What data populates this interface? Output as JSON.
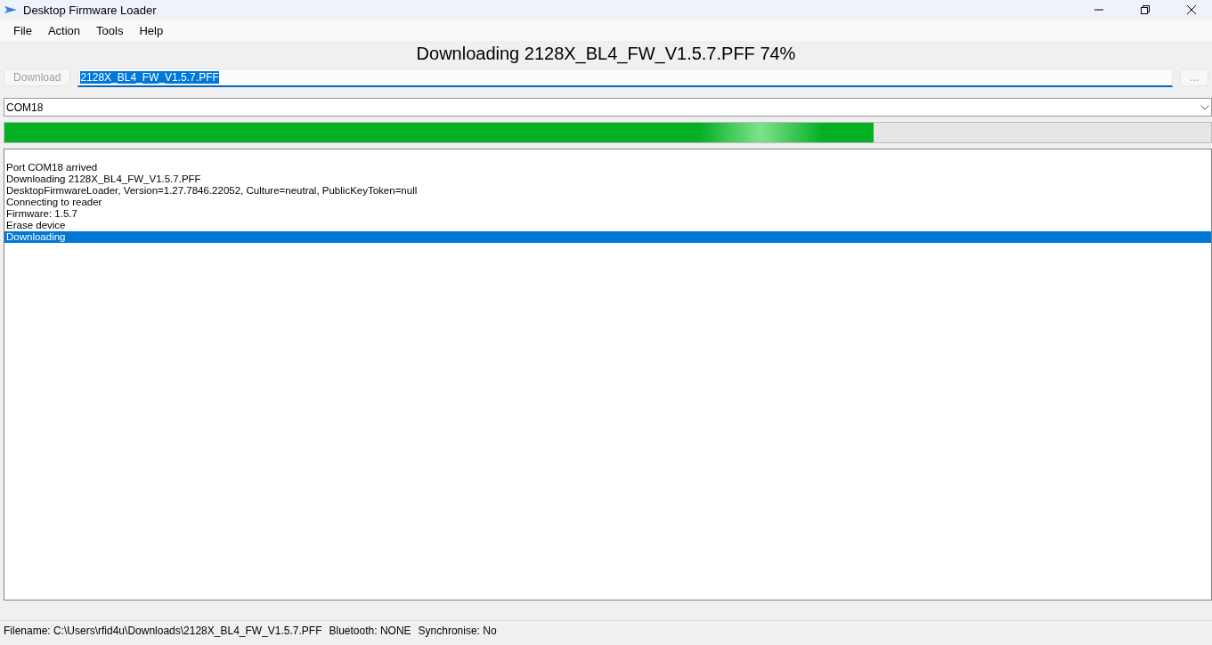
{
  "window": {
    "title": "Desktop Firmware Loader"
  },
  "menu": [
    "File",
    "Action",
    "Tools",
    "Help"
  ],
  "heading": "Downloading 2128X_BL4_FW_V1.5.7.PFF 74%",
  "download_button": {
    "label": "Download",
    "disabled": true
  },
  "file_field": {
    "value": "2128X_BL4_FW_V1.5.7.PFF",
    "selected": true
  },
  "browse_button": {
    "label": "...",
    "disabled": true
  },
  "port_select": {
    "value": "COM18"
  },
  "progress": {
    "level": 0.72
  },
  "log": [
    {
      "text": "Port COM18 arrived",
      "selected": false
    },
    {
      "text": "Downloading 2128X_BL4_FW_V1.5.7.PFF",
      "selected": false
    },
    {
      "text": "DesktopFirmwareLoader, Version=1.27.7846.22052, Culture=neutral, PublicKeyToken=null",
      "selected": false
    },
    {
      "text": "Connecting to reader",
      "selected": false
    },
    {
      "text": "Firmware: 1.5.7",
      "selected": false
    },
    {
      "text": "Erase device",
      "selected": false
    },
    {
      "text": "Downloading",
      "selected": true
    }
  ],
  "status_bar": [
    "Filename: C:\\Users\\rfid4u\\Downloads\\2128X_BL4_FW_V1.5.7.PFF",
    "Bluetooth: NONE",
    "Synchronise: No"
  ]
}
